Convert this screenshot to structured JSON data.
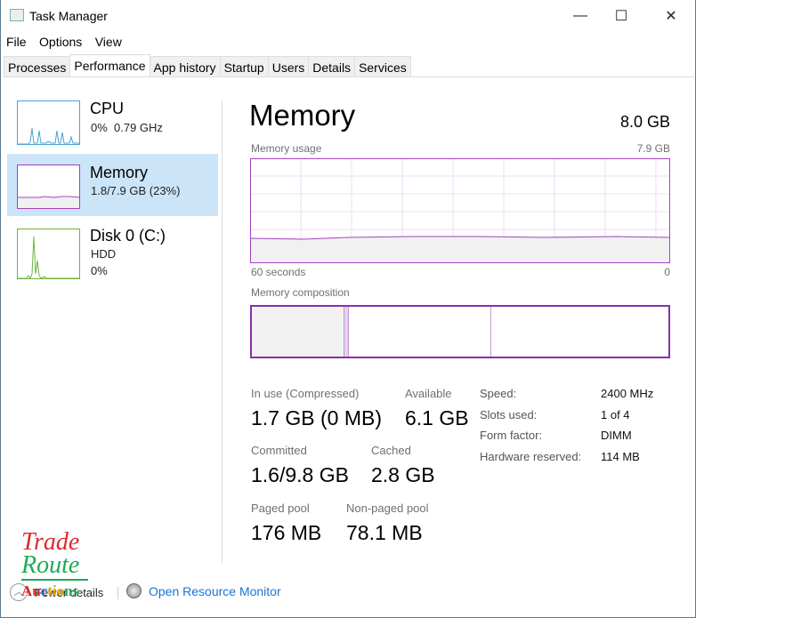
{
  "window": {
    "title": "Task Manager",
    "minimize": "—",
    "maximize": "☐",
    "close": "✕"
  },
  "menu": [
    "File",
    "Options",
    "View"
  ],
  "tabs": [
    "Processes",
    "Performance",
    "App history",
    "Startup",
    "Users",
    "Details",
    "Services"
  ],
  "sidebar": [
    {
      "name": "CPU",
      "line1": "0%  0.79 GHz",
      "color": "#4aa3d9"
    },
    {
      "name": "Memory",
      "line1": "1.8/7.9 GB (23%)",
      "color": "#a341c2"
    },
    {
      "name": "Disk 0 (C:)",
      "line1": "HDD",
      "line2": "0%",
      "color": "#6fb33f"
    }
  ],
  "main": {
    "title": "Memory",
    "total": "8.0 GB",
    "usage_label": "Memory usage",
    "usage_max": "7.9 GB",
    "axis_left": "60 seconds",
    "axis_right": "0",
    "composition_label": "Memory composition",
    "usage_fraction": 0.23,
    "stats": [
      {
        "label": "In use (Compressed)",
        "value": "1.7 GB (0 MB)"
      },
      {
        "label": "Available",
        "value": "6.1 GB"
      },
      {
        "label": "Committed",
        "value": "1.6/9.8 GB"
      },
      {
        "label": "Cached",
        "value": "2.8 GB"
      },
      {
        "label": "Paged pool",
        "value": "176 MB"
      },
      {
        "label": "Non-paged pool",
        "value": "78.1 MB"
      }
    ],
    "specs": [
      {
        "label": "Speed:",
        "value": "2400 MHz"
      },
      {
        "label": "Slots used:",
        "value": "1 of 4"
      },
      {
        "label": "Form factor:",
        "value": "DIMM"
      },
      {
        "label": "Hardware reserved:",
        "value": "114 MB"
      }
    ]
  },
  "footer": {
    "fewer": "Fewer details",
    "monitor": "Open Resource Monitor"
  },
  "watermark": {
    "l1": "Trade",
    "l2": "Route",
    "l3": "Auctions"
  }
}
